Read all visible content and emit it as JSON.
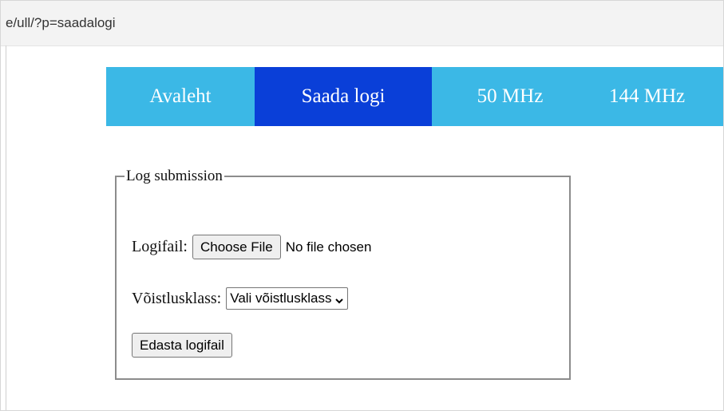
{
  "browser": {
    "url": "e/ull/?p=saadalogi"
  },
  "nav": {
    "tabs": [
      {
        "label": "Avaleht"
      },
      {
        "label": "Saada logi",
        "active": true
      },
      {
        "label": "50 MHz"
      },
      {
        "label": "144 MHz"
      }
    ]
  },
  "form": {
    "legend": "Log submission",
    "logfile_label": "Logifail:",
    "choose_file_button": "Choose File",
    "file_status": "No file chosen",
    "class_label": "Võistlusklass:",
    "class_select_value": "Vali võistlusklass",
    "submit_button": "Edasta logifail"
  },
  "colors": {
    "nav_bg": "#3bb8e6",
    "nav_active_bg": "#0a3fd8",
    "nav_text": "#ffffff"
  },
  "icons": {
    "select_arrow": "chevron-down-icon"
  }
}
